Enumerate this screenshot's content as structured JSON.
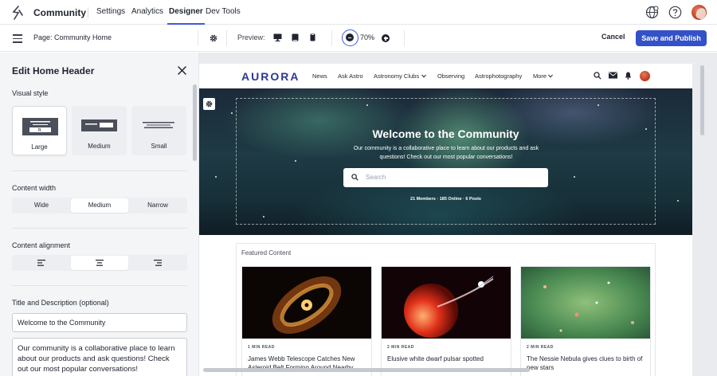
{
  "topnav": {
    "brand": "Community",
    "tabs": [
      {
        "label": "Settings",
        "active": false
      },
      {
        "label": "Analytics",
        "active": false
      },
      {
        "label": "Designer",
        "active": true
      },
      {
        "label": "Dev Tools",
        "active": false
      }
    ],
    "icons": [
      "globe-icon",
      "help-icon",
      "avatar"
    ]
  },
  "toolbar": {
    "page_label": "Page: Community Home",
    "preview_label": "Preview:",
    "devices": [
      "desktop-icon",
      "tablet-icon",
      "mobile-icon"
    ],
    "zoom": "70%",
    "cancel_label": "Cancel",
    "publish_label": "Save and Publish"
  },
  "panel": {
    "title": "Edit Home Header",
    "visual_style": {
      "label": "Visual style",
      "options": [
        {
          "label": "Large",
          "selected": true
        },
        {
          "label": "Medium",
          "selected": false
        },
        {
          "label": "Small",
          "selected": false
        }
      ]
    },
    "content_width": {
      "label": "Content width",
      "options": [
        {
          "label": "Wide",
          "selected": false
        },
        {
          "label": "Medium",
          "selected": true
        },
        {
          "label": "Narrow",
          "selected": false
        }
      ]
    },
    "content_alignment": {
      "label": "Content alignment",
      "options": [
        "align-left-icon",
        "align-center-icon",
        "align-right-icon"
      ],
      "selected": "align-center-icon"
    },
    "title_desc": {
      "label": "Title and Description (optional)",
      "title_value": "Welcome to the Community",
      "desc_value": "Our community is a collaborative place to learn about our products and ask questions! Check out our most popular conversations!"
    }
  },
  "site": {
    "logo": "AURORA",
    "nav": [
      "News",
      "Ask Astro",
      "Astronomy Clubs",
      "Observing",
      "Astrophotography",
      "More"
    ],
    "hero": {
      "title": "Welcome to the Community",
      "description": "Our community is a collaborative place to learn about our products and ask questions! Check out our most popular conversations!",
      "search_placeholder": "Search",
      "stats": "21 Members · 185 Online · 6 Posts"
    },
    "featured": {
      "title": "Featured Content",
      "cards": [
        {
          "meta": "1 MIN READ",
          "title": "James Webb Telescope Catches New Asteroid Belt Forming Around Nearby"
        },
        {
          "meta": "2 MIN READ",
          "title": "Elusive white dwarf pulsar spotted"
        },
        {
          "meta": "2 MIN READ",
          "title": "The Nessie Nebula gives clues to birth of new stars"
        }
      ]
    }
  },
  "colors": {
    "accent": "#3451c7",
    "logo": "#2c3a8c"
  }
}
